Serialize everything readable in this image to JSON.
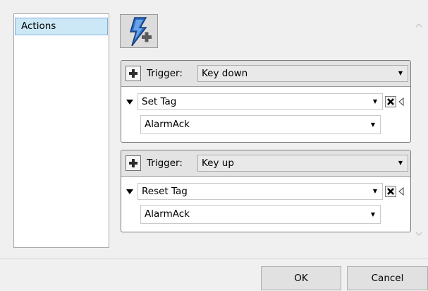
{
  "actions_list": {
    "items": [
      {
        "label": "Actions",
        "selected": true
      }
    ]
  },
  "add_action_button": {
    "icon": "lightning-plus-icon"
  },
  "triggers": [
    {
      "trigger_label": "Trigger:",
      "trigger_value": "Key down",
      "action_value": "Set Tag",
      "parameter_value": "AlarmAck"
    },
    {
      "trigger_label": "Trigger:",
      "trigger_value": "Key up",
      "action_value": "Reset Tag",
      "parameter_value": "AlarmAck"
    }
  ],
  "buttons": {
    "ok": "OK",
    "cancel": "Cancel"
  },
  "colors": {
    "background": "#f0f0f0",
    "selected_item": "#cce8f6",
    "header": "#e3e3e3",
    "lightning": "#2e6cc4"
  }
}
